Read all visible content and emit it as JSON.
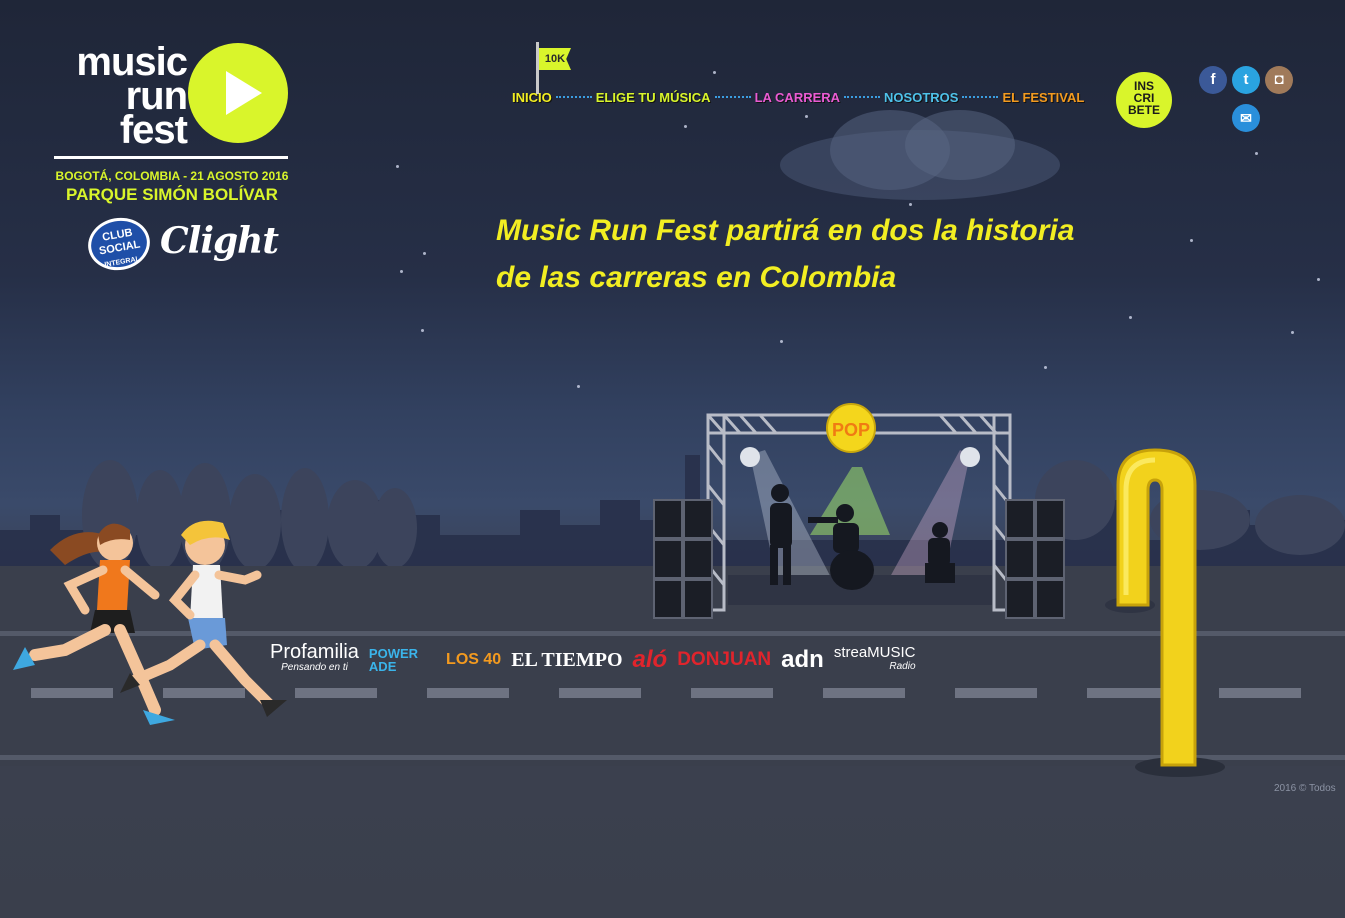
{
  "logo": {
    "line1": "music",
    "line2": "run",
    "line3": "fest",
    "date": "BOGOTÁ, COLOMBIA - 21 AGOSTO 2016",
    "venue": "PARQUE SIMÓN BOLÍVAR",
    "icon": "play-icon"
  },
  "sponsors_top": {
    "club_social": "CLUB SOCIAL",
    "club_social_sub": "INTEGRAL",
    "clight": "Clight"
  },
  "nav": {
    "flag_label": "10K",
    "items": [
      {
        "label": "INICIO",
        "color": "#f2ee22"
      },
      {
        "label": "ELIGE TU MÚSICA",
        "color": "#d9f52b"
      },
      {
        "label": "LA CARRERA",
        "color": "#ea5bd3"
      },
      {
        "label": "NOSOTROS",
        "color": "#4ec2ea"
      },
      {
        "label": "EL FESTIVAL",
        "color": "#f39a1f"
      }
    ],
    "inscribete_lines": [
      "INS",
      "CRI",
      "BETE"
    ]
  },
  "social": [
    {
      "name": "facebook",
      "glyph": "f",
      "color": "#3b5998"
    },
    {
      "name": "twitter",
      "glyph": "t",
      "color": "#2aa3e0"
    },
    {
      "name": "instagram",
      "glyph": "◘",
      "color": "#a07a5a"
    },
    {
      "name": "email",
      "glyph": "✉",
      "color": "#2a8fdb"
    }
  ],
  "headline": {
    "line1": "Music Run Fest partirá en dos la historia",
    "line2": "de las carreras en Colombia"
  },
  "stage": {
    "badge": "POP"
  },
  "sponsors_bottom": [
    {
      "label": "Profamilia",
      "sub": "Pensando en ti"
    },
    {
      "label": "POWER",
      "sub": "ADE"
    },
    {
      "label": "LOS 40",
      "sub": ""
    },
    {
      "label": "EL TIEMPO",
      "sub": ""
    },
    {
      "label": "aló",
      "sub": ""
    },
    {
      "label": "DONJUAN",
      "sub": ""
    },
    {
      "label": "adn",
      "sub": ""
    },
    {
      "label": "streaMUSIC",
      "sub": "Radio"
    }
  ],
  "footer": {
    "copyright": "2016 © Todos"
  },
  "colors": {
    "accent_lime": "#d9f52b",
    "headline_yellow": "#f2ee22",
    "arch_yellow": "#f4d61c"
  }
}
